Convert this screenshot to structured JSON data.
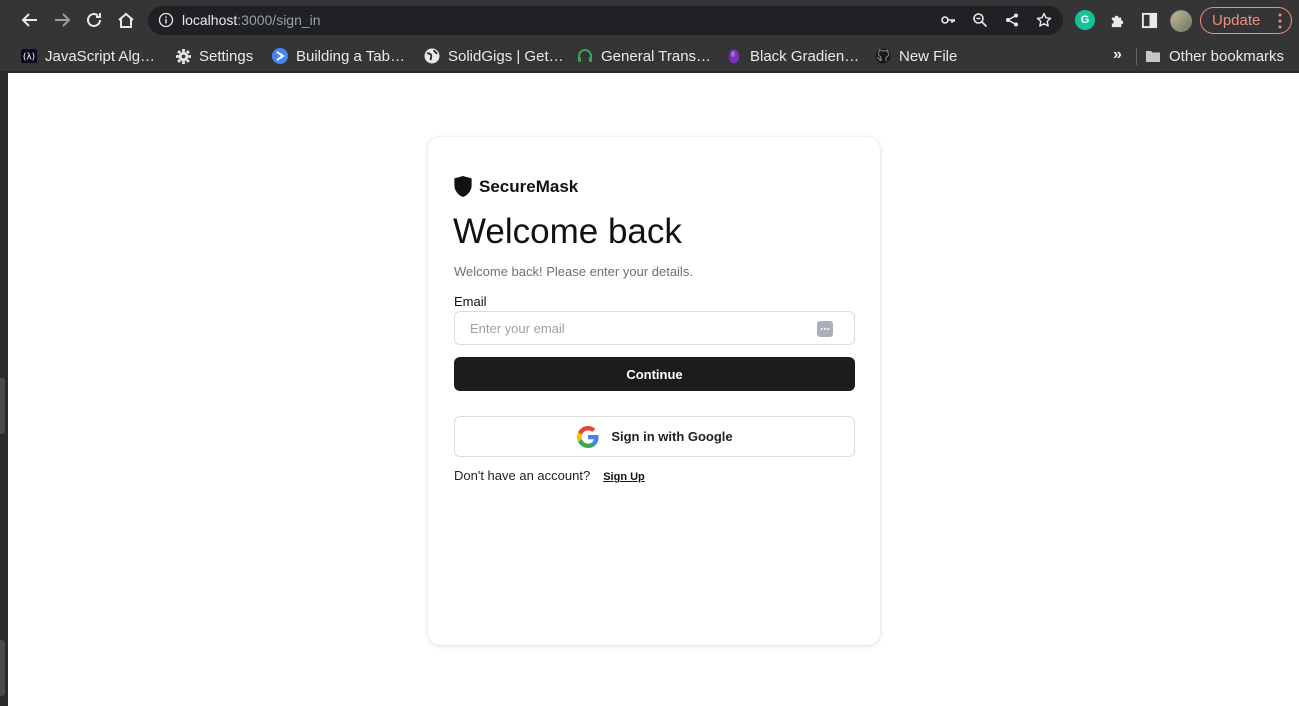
{
  "browser": {
    "url_host": "localhost",
    "url_path": ":3000/sign_in",
    "update_label": "Update",
    "extension_letter": "G",
    "bookmarks": [
      {
        "label": "JavaScript Alg…",
        "icon": "fcc-icon"
      },
      {
        "label": "Settings",
        "icon": "gear-icon"
      },
      {
        "label": "Building a Tab…",
        "icon": "arrow-play-icon"
      },
      {
        "label": "SolidGigs | Get…",
        "icon": "globe-icon"
      },
      {
        "label": "General Trans…",
        "icon": "headset-icon"
      },
      {
        "label": "Black Gradien…",
        "icon": "purple-drop-icon"
      },
      {
        "label": "New File",
        "icon": "github-icon"
      }
    ],
    "other_bookmarks_label": "Other bookmarks",
    "more_label": "»"
  },
  "signin": {
    "brand_name": "SecureMask",
    "heading": "Welcome back",
    "subtitle": "Welcome back! Please enter your details.",
    "email_label": "Email",
    "email_placeholder": "Enter your email",
    "email_value": "",
    "continue_label": "Continue",
    "google_label": "Sign in with Google",
    "no_account_text": "Don't have an account?",
    "signup_label": "Sign Up"
  },
  "colors": {
    "chrome_bg": "#353535",
    "omnibox_bg": "#202124",
    "update_accent": "#f28b82",
    "primary_button": "#1c1c1c",
    "page_bg": "#ffffff"
  }
}
